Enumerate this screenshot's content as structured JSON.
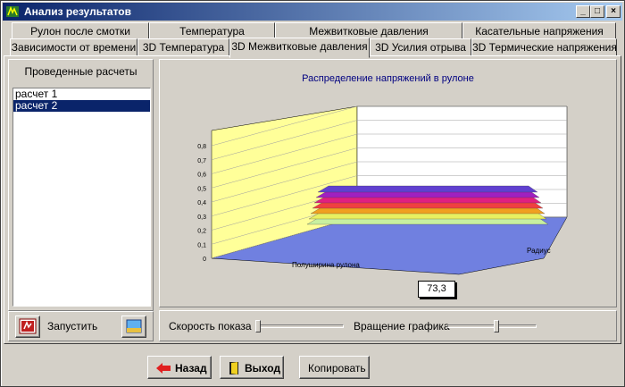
{
  "window": {
    "title": "Анализ результатов"
  },
  "tabs_row1": [
    "Рулон после смотки",
    "Температура",
    "Межвитковые давления",
    "Касательные напряжения"
  ],
  "tabs_row2": [
    "Зависимости от времени",
    "3D Температура",
    "3D Межвитковые давления",
    "3D Усилия отрыва",
    "3D Термические напряжения"
  ],
  "active_tab": "3D Межвитковые давления",
  "left_panel": {
    "title": "Проведенные расчеты",
    "items": [
      "расчет 1",
      "расчет 2"
    ],
    "selected_item": "расчет 2",
    "run_label": "Запустить"
  },
  "chart_data": {
    "type": "area",
    "title": "Распределение напряжений в рулоне",
    "xlabel": "Полуширина рулона",
    "zlabel": "Радиус",
    "ylim": [
      0,
      0.8
    ],
    "y_ticks": [
      "0",
      "0,1",
      "0,2",
      "0,3",
      "0,4",
      "0,5",
      "0,6",
      "0,7",
      "0,8"
    ],
    "grid": true,
    "surface_bands": [
      "#c8f0a0",
      "#e8f060",
      "#f0a020",
      "#f04040",
      "#e02080",
      "#a020c0",
      "#6040d0"
    ],
    "back_wall_color": "#ffff99",
    "value_box": "73,3"
  },
  "controls": {
    "speed_label": "Скорость показа",
    "speed_value": 0,
    "rotation_label": "Вращение графика",
    "rotation_value": 0.55
  },
  "buttons": {
    "back": "Назад",
    "exit": "Выход",
    "copy": "Копировать"
  }
}
